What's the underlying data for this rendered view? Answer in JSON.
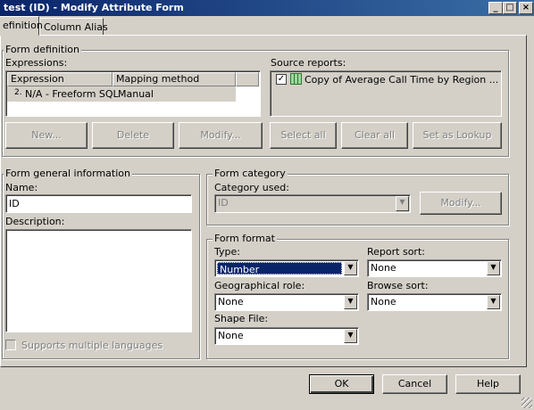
{
  "window": {
    "title": "test (ID) - Modify Attribute Form",
    "minimize_glyph": "_",
    "maximize_glyph": "□",
    "close_glyph": "×"
  },
  "tabs": [
    {
      "label": "efinition",
      "active": true
    },
    {
      "label": "Column Alias",
      "active": false
    }
  ],
  "form_definition": {
    "legend": "Form definition",
    "expressions_label": "Expressions:",
    "columns": [
      "Expression",
      "Mapping method"
    ],
    "rows": [
      {
        "icon": "2.",
        "expression": "N/A - Freeform SQL",
        "mapping": "Manual"
      }
    ],
    "source_reports_label": "Source reports:",
    "source_reports": [
      {
        "checked": true,
        "label": "Copy of Average Call Time by Region ..."
      }
    ],
    "buttons": {
      "new": "New...",
      "delete": "Delete",
      "modify": "Modify...",
      "select_all": "Select all",
      "clear_all": "Clear all",
      "set_as_lookup": "Set as Lookup"
    }
  },
  "general_info": {
    "legend": "Form general information",
    "name_label": "Name:",
    "name_value": "ID",
    "description_label": "Description:",
    "description_value": "",
    "supports_multiple_languages": "Supports multiple languages"
  },
  "category": {
    "legend": "Form category",
    "category_used_label": "Category used:",
    "category_used_value": "ID",
    "modify_button": "Modify..."
  },
  "format": {
    "legend": "Form format",
    "type_label": "Type:",
    "type_value": "Number",
    "report_sort_label": "Report sort:",
    "report_sort_value": "None",
    "geo_role_label": "Geographical role:",
    "geo_role_value": "None",
    "browse_sort_label": "Browse sort:",
    "browse_sort_value": "None",
    "shape_file_label": "Shape File:",
    "shape_file_value": "None"
  },
  "dialog_buttons": {
    "ok": "OK",
    "cancel": "Cancel",
    "help": "Help"
  },
  "colors": {
    "title_start": "#0a246a",
    "title_end": "#3a6ea5",
    "selection": "#0a246a",
    "face": "#d4d0c8"
  }
}
